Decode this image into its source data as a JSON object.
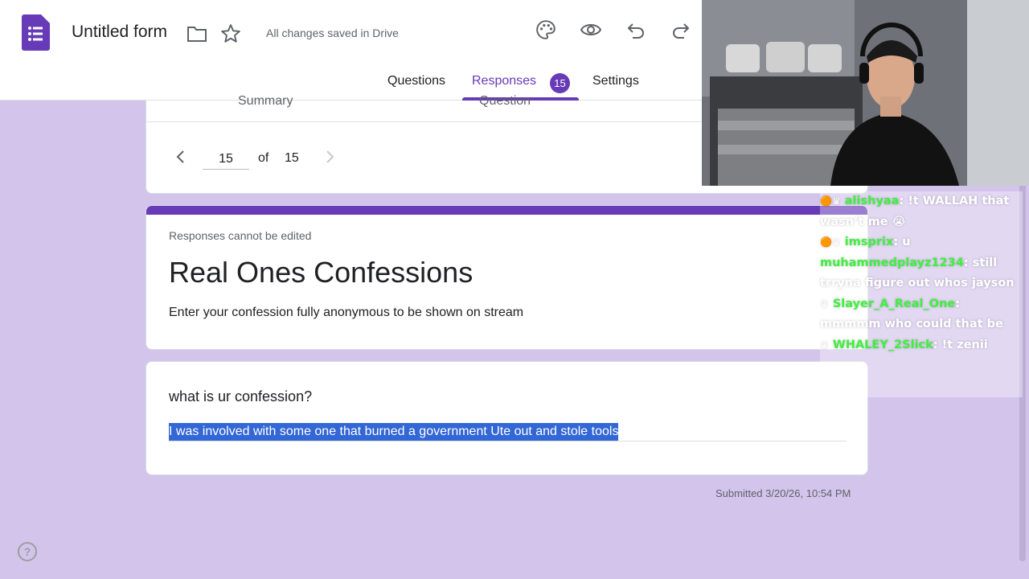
{
  "header": {
    "title": "Untitled form",
    "saved_status": "All changes saved in Drive",
    "icons": [
      "forms-logo-icon",
      "folder-icon",
      "star-icon",
      "palette-icon",
      "preview-eye-icon",
      "undo-icon",
      "redo-icon"
    ],
    "tabs": [
      {
        "label": "Questions"
      },
      {
        "label": "Responses"
      },
      {
        "label": "Settings"
      }
    ],
    "responses_count": "15",
    "accent_color": "#673ab7"
  },
  "responses_nav": {
    "subtabs": [
      {
        "label": "Summary"
      },
      {
        "label": "Question"
      }
    ],
    "current": "15",
    "of_label": "of",
    "total": "15"
  },
  "form": {
    "notice": "Responses cannot be edited",
    "heading": "Real Ones Confessions",
    "description": "Enter your confession fully anonymous to be shown on stream"
  },
  "question": {
    "text": "what is ur confession?",
    "answer": "I was involved with some one that burned a government Ute out and stole tools"
  },
  "submitted": "Submitted 3/20/26, 10:54 PM",
  "chat": {
    "messages": [
      {
        "user": "alishyaa",
        "text": ": !t WALLAH that wasn’t me 😭"
      },
      {
        "user": "imsprix",
        "text": ": u"
      },
      {
        "user": "muhammedplayz1234",
        "text": ": still trryna figure out whos jayson"
      },
      {
        "user": "Slayer_A_Real_One",
        "text": ": mmmmm who could that be"
      },
      {
        "user": "WHALEY_2Slick",
        "text": ": !t zenii"
      }
    ]
  }
}
